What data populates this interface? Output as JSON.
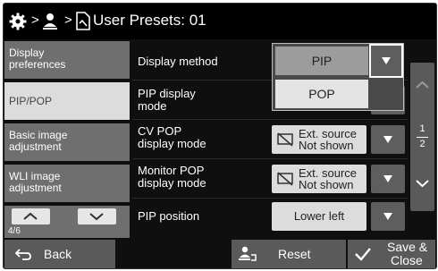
{
  "header": {
    "title": "User Presets: 01",
    "icons": [
      "gear-icon",
      "user-icon",
      "preset-page-icon"
    ],
    "separator": ">"
  },
  "sidebar": {
    "items": [
      {
        "label": "Display preferences",
        "line1": "Display",
        "line2": "preferences",
        "active": false
      },
      {
        "label": "PIP/POP",
        "line1": "PIP/POP",
        "line2": "",
        "active": true
      },
      {
        "label": "Basic image adjustment",
        "line1": "Basic image",
        "line2": "adjustment",
        "active": false
      },
      {
        "label": "WLI image adjustment",
        "line1": "WLI image",
        "line2": "adjustment",
        "active": false
      }
    ],
    "page_indicator": "4/6"
  },
  "rows": [
    {
      "line1": "Display method",
      "line2": "",
      "value": "PIP"
    },
    {
      "line1": "PIP display",
      "line2": "mode",
      "value": "POP"
    },
    {
      "line1": "CV POP",
      "line2": "display mode",
      "value1": "Ext. source",
      "value2": "Not shown"
    },
    {
      "line1": "Monitor POP",
      "line2": "display mode",
      "value1": "Ext. source",
      "value2": "Not shown"
    },
    {
      "line1": "PIP position",
      "line2": "",
      "value": "Lower left"
    }
  ],
  "dropdown": {
    "options": [
      "PIP",
      "POP"
    ],
    "selected": "PIP"
  },
  "scroller": {
    "current": "1",
    "total": "2"
  },
  "footer": {
    "back": "Back",
    "reset": "Reset",
    "save_line1": "Save &",
    "save_line2": "Close"
  },
  "colors": {
    "background": "#0f0f0f",
    "sidebar_item": "#6f6f6f",
    "sidebar_active": "#dcdcdc",
    "value_field": "#dcdcdc",
    "arrow_button": "#5e5e5e",
    "dropdown_selected": "#9c9c9c"
  }
}
